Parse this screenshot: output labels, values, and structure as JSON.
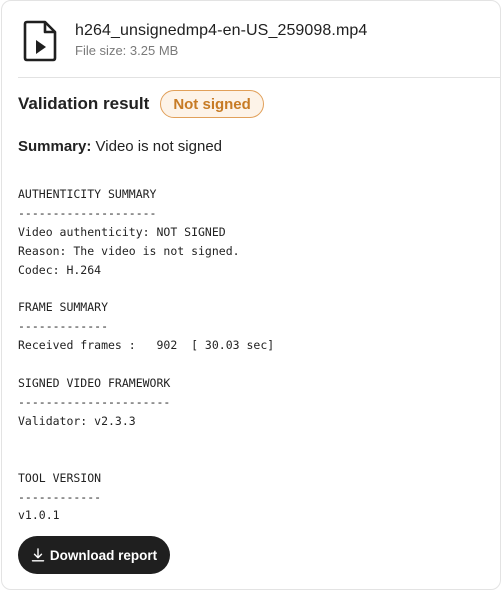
{
  "file": {
    "name": "h264_unsignedmp4-en-US_259098.mp4",
    "size_label": "File size: 3.25 MB",
    "icon": "video-file-icon"
  },
  "validation": {
    "title": "Validation result",
    "status": "Not signed",
    "status_color": "#c77b25"
  },
  "summary": {
    "label": "Summary:",
    "value": "Video is not signed"
  },
  "report": {
    "authenticity_heading": "AUTHENTICITY SUMMARY",
    "authenticity_rule": "--------------------",
    "video_authenticity": "Video authenticity: NOT SIGNED",
    "reason": "Reason: The video is not signed.",
    "codec": "Codec: H.264",
    "frame_heading": "FRAME SUMMARY",
    "frame_rule": "-------------",
    "received_frames": "Received frames :   902  [ 30.03 sec]",
    "framework_heading": "SIGNED VIDEO FRAMEWORK",
    "framework_rule": "----------------------",
    "validator": "Validator: v2.3.3",
    "tool_heading": "TOOL VERSION",
    "tool_rule": "------------",
    "tool_version": "v1.0.1"
  },
  "actions": {
    "download_label": "Download report",
    "download_icon": "download-icon"
  }
}
